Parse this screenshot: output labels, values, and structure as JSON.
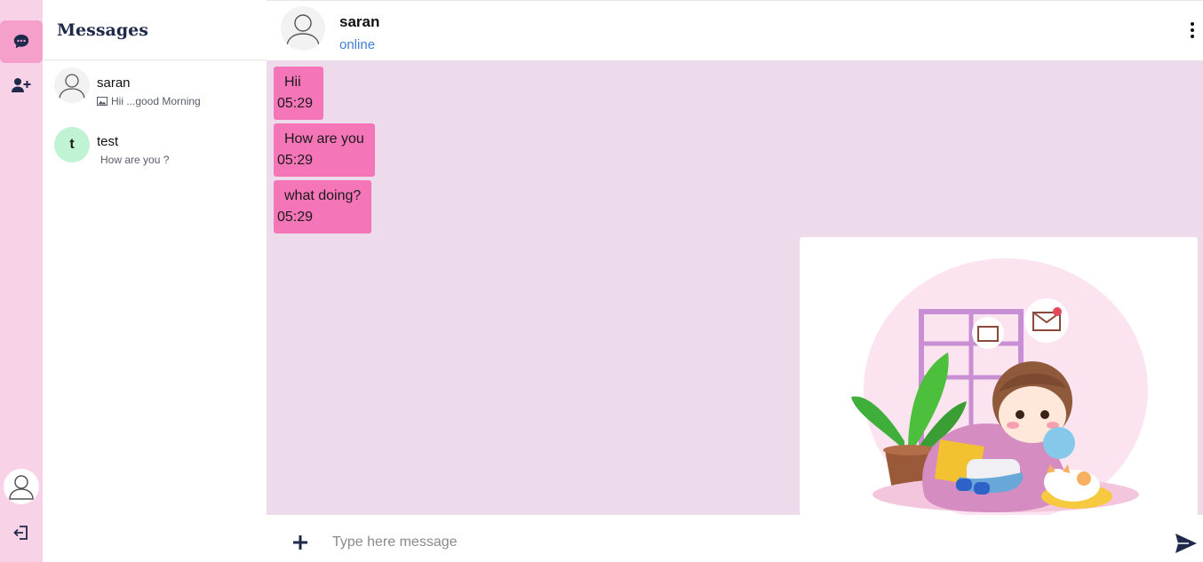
{
  "rail": {
    "items": [
      {
        "icon": "chat-bubble-icon",
        "active": true
      },
      {
        "icon": "add-user-icon",
        "active": false
      }
    ],
    "profile_icon": "user-avatar-icon",
    "logout_icon": "logout-icon"
  },
  "conversations": {
    "title": "Messages",
    "items": [
      {
        "name": "saran",
        "preview": "Hii ...good Morning",
        "avatar": "user-placeholder",
        "preview_icon": "image-icon"
      },
      {
        "name": "test",
        "preview": "How are you ?",
        "avatar_letter": "t"
      }
    ]
  },
  "chat": {
    "contact_name": "saran",
    "status": "online",
    "menu_icon": "kebab-menu-icon",
    "messages": [
      {
        "text": "Hii",
        "time": "05:29"
      },
      {
        "text": "How are you",
        "time": "05:29"
      },
      {
        "text": "what doing?",
        "time": "05:29"
      }
    ],
    "image_message": {
      "icon": "illustration-image"
    }
  },
  "composer": {
    "placeholder": "Type here message",
    "value": "",
    "attach_icon": "plus-icon",
    "send_icon": "send-icon"
  },
  "colors": {
    "rail_bg": "#f8d2e6",
    "rail_active": "#f59fcb",
    "chat_bg": "#eddbeb",
    "bubble": "#f475b8",
    "status": "#3f7fd6",
    "title": "#1e2a4a"
  }
}
